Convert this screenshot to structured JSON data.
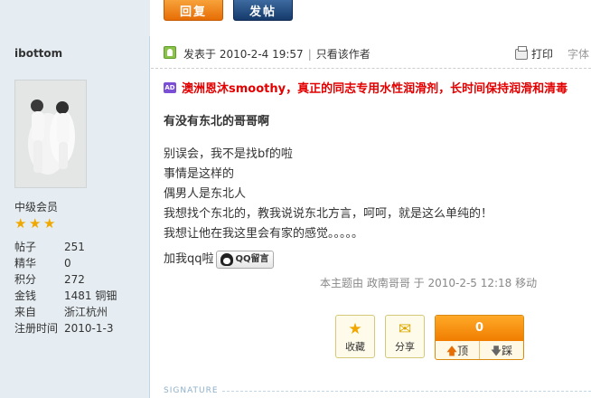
{
  "toolbar": {
    "reply_label": "回复",
    "post_label": "发帖"
  },
  "profile": {
    "username": "ibottom",
    "rank": "中级会员",
    "stars": 3,
    "stats": [
      {
        "key": "帖子",
        "value": "251"
      },
      {
        "key": "精华",
        "value": "0"
      },
      {
        "key": "积分",
        "value": "272"
      },
      {
        "key": "金钱",
        "value": "1481 铜钿"
      },
      {
        "key": "来自",
        "value": "浙江杭州"
      },
      {
        "key": "注册时间",
        "value": "2010-1-3"
      }
    ]
  },
  "post": {
    "posted_at": "发表于 2010-2-4 19:57",
    "only_author": "只看该作者",
    "print_label": "打印",
    "font_label": "字体",
    "ad_badge": "AD",
    "ad_text": "澳洲恩沐smoothy，真正的同志专用水性润滑剂，长时间保持润滑和清毒",
    "title": "有没有东北的哥哥啊",
    "lines": [
      "别误会，我不是找bf的啦",
      "事情是这样的",
      "偶男人是东北人",
      "我想找个东北的，教我说说东北方言，呵呵，就是这么单纯的！",
      "我想让他在我这里会有家的感觉。。。。。"
    ],
    "qq_text": "加我qq啦",
    "qq_button": "QQ留言",
    "moved_note": "本主题由 政南哥哥 于 2010-2-5 12:18 移动"
  },
  "actions": {
    "favorite": "收藏",
    "share": "分享",
    "vote_count": "0",
    "up": "顶",
    "down": "踩"
  },
  "signature": {
    "label": "SIGNATURE"
  }
}
